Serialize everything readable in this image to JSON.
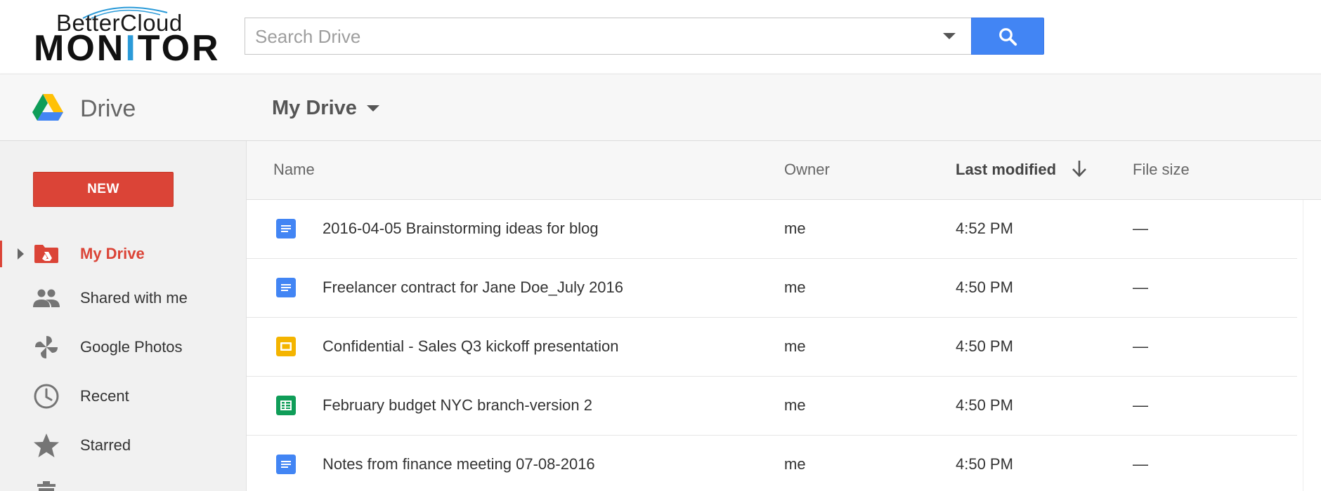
{
  "brand": {
    "logo_top": "BetterCloud",
    "logo_bottom_prefix": "MON",
    "logo_bottom_accent": "I",
    "logo_bottom_suffix": "TOR",
    "accent_color": "#2a9ad8"
  },
  "search": {
    "placeholder": "Search Drive",
    "value": "",
    "button_icon": "search-icon",
    "button_color": "#4285f4"
  },
  "header": {
    "app_title": "Drive",
    "location_menu": "My Drive"
  },
  "sidebar": {
    "new_button": "NEW",
    "items": [
      {
        "label": "My Drive",
        "icon": "my-drive-folder-icon",
        "active": true
      },
      {
        "label": "Shared with me",
        "icon": "people-icon",
        "active": false
      },
      {
        "label": "Google Photos",
        "icon": "photos-pinwheel-icon",
        "active": false
      },
      {
        "label": "Recent",
        "icon": "clock-icon",
        "active": false
      },
      {
        "label": "Starred",
        "icon": "star-icon",
        "active": false
      }
    ],
    "active_color": "#db4437"
  },
  "table": {
    "columns": {
      "name": "Name",
      "owner": "Owner",
      "last_modified": "Last modified",
      "file_size": "File size"
    },
    "sort": {
      "column": "last_modified",
      "direction": "descending",
      "icon": "arrow-down-icon"
    },
    "rows": [
      {
        "name": "2016-04-05 Brainstorming ideas for blog",
        "type": "doc",
        "owner": "me",
        "modified": "4:52 PM",
        "size": "—"
      },
      {
        "name": "Freelancer contract for Jane Doe_July 2016",
        "type": "doc",
        "owner": "me",
        "modified": "4:50 PM",
        "size": "—"
      },
      {
        "name": "Confidential - Sales Q3 kickoff presentation",
        "type": "slides",
        "owner": "me",
        "modified": "4:50 PM",
        "size": "—"
      },
      {
        "name": "February budget NYC branch-version 2",
        "type": "sheet",
        "owner": "me",
        "modified": "4:50 PM",
        "size": "—"
      },
      {
        "name": "Notes from finance meeting 07-08-2016",
        "type": "doc",
        "owner": "me",
        "modified": "4:50 PM",
        "size": "—"
      }
    ],
    "type_colors": {
      "doc": "#4285f4",
      "slides": "#f4b400",
      "sheet": "#0f9d58"
    }
  }
}
